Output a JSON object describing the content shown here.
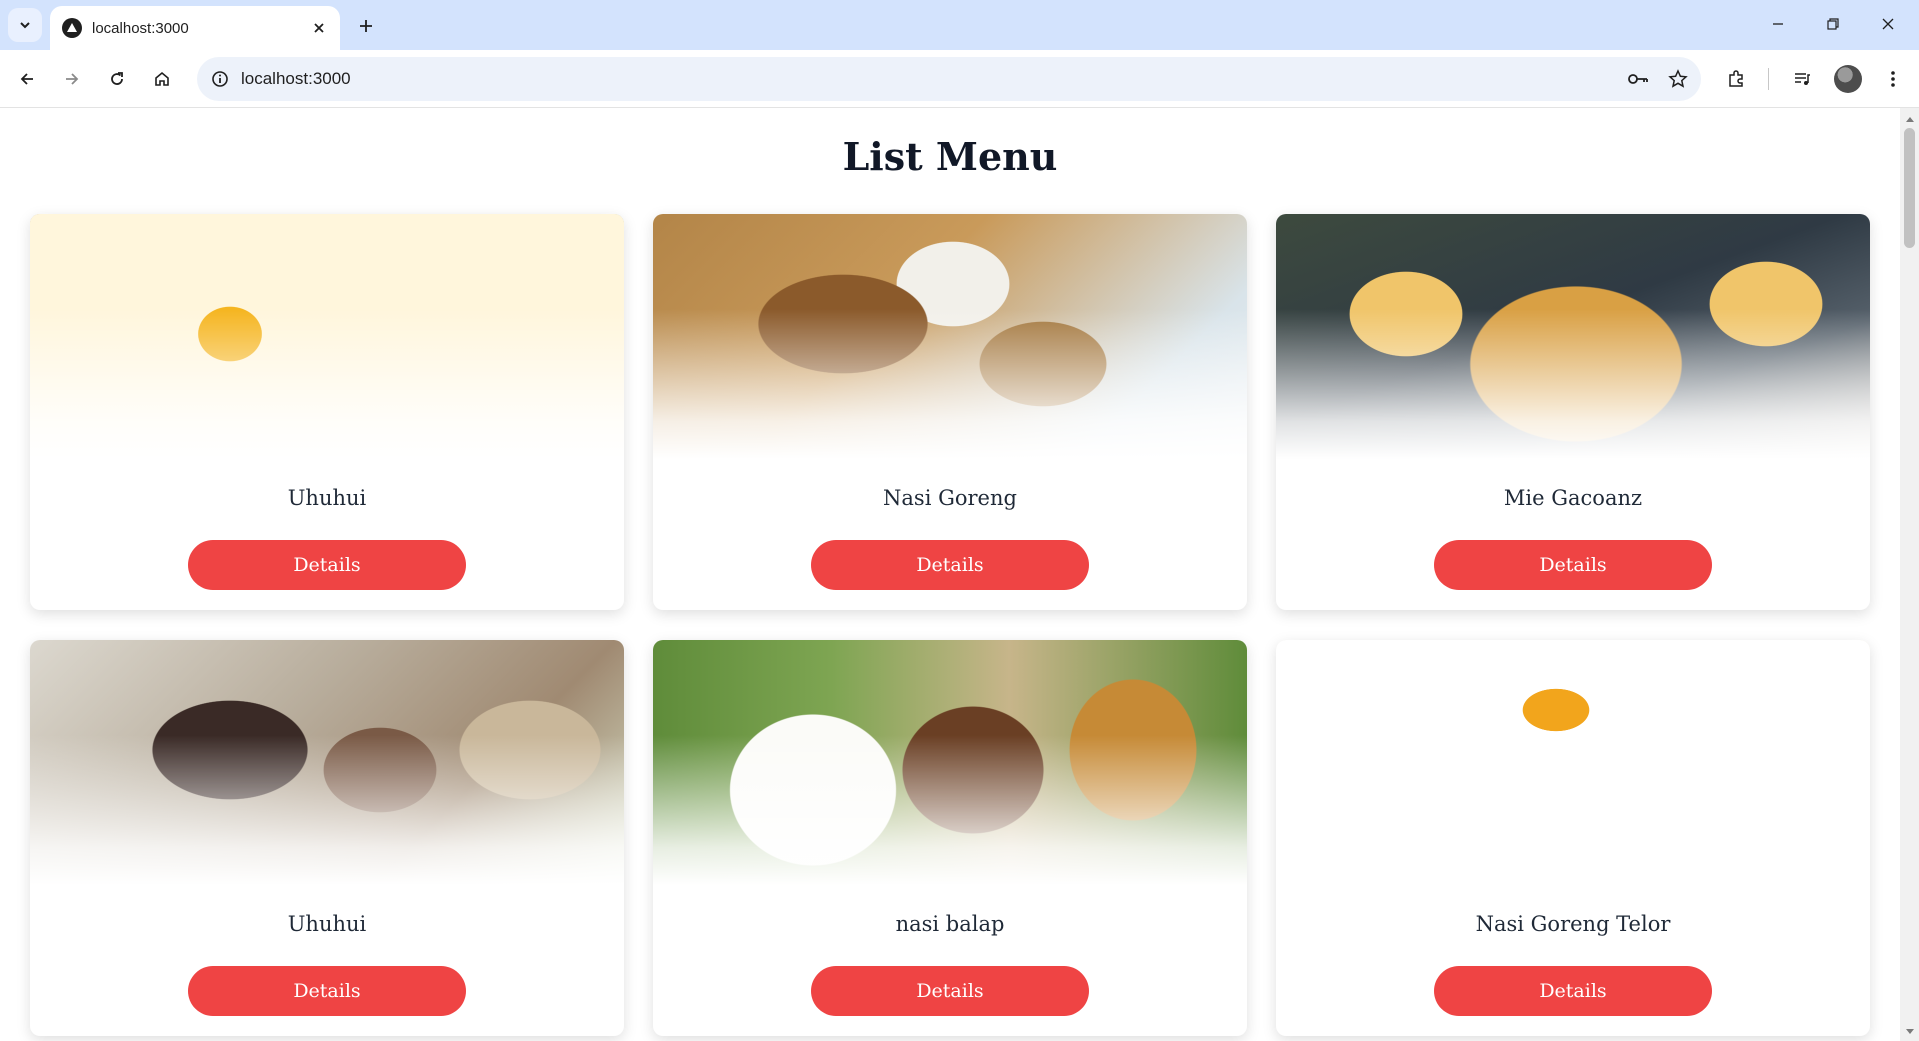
{
  "browser": {
    "tab_title": "localhost:3000",
    "url": "localhost:3000",
    "icons": {
      "tab_search": "chevron-down-icon",
      "favicon": "triangle-logo-icon",
      "tab_close": "close-icon",
      "new_tab": "plus-icon",
      "back": "arrow-left-icon",
      "forward": "arrow-right-icon",
      "reload": "reload-icon",
      "home": "home-icon",
      "site_info": "info-icon",
      "password": "key-icon",
      "bookmark": "star-icon",
      "extensions": "puzzle-icon",
      "media": "media-playlist-icon",
      "profile": "avatar",
      "menu": "more-vertical-icon",
      "minimize": "minimize-icon",
      "restore": "restore-icon",
      "close_window": "close-icon"
    }
  },
  "page": {
    "title": "List Menu",
    "accent_color": "#ef4444",
    "menu_items": [
      {
        "name": "Uhuhui",
        "button_label": "Details"
      },
      {
        "name": "Nasi Goreng",
        "button_label": "Details"
      },
      {
        "name": "Mie Gacoanz",
        "button_label": "Details"
      },
      {
        "name": "Uhuhui",
        "button_label": "Details"
      },
      {
        "name": "nasi balap",
        "button_label": "Details"
      },
      {
        "name": "Nasi Goreng Telor",
        "button_label": "Details"
      }
    ]
  }
}
